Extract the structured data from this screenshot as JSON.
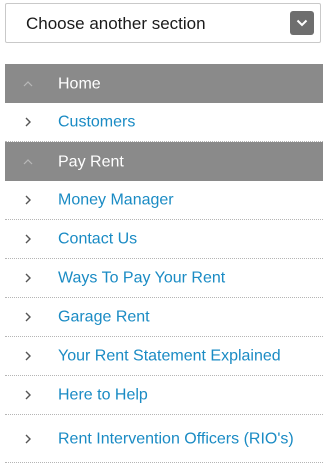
{
  "section_select": {
    "selected": "Choose another section",
    "arrow_icon": "chevron-down-icon"
  },
  "colors": {
    "link": "#1a8bc4",
    "active_bg": "#8a8a8a",
    "active_text": "#ffffff",
    "arrow_bg": "#6e6e6e"
  },
  "nav": {
    "items": [
      {
        "label": "Home",
        "state": "expanded",
        "icon": "chevron-up-icon"
      },
      {
        "label": "Customers",
        "state": "link",
        "icon": "chevron-right-icon"
      },
      {
        "label": "Pay Rent",
        "state": "expanded",
        "icon": "chevron-up-icon"
      },
      {
        "label": "Money Manager",
        "state": "link",
        "icon": "chevron-right-icon"
      },
      {
        "label": "Contact Us",
        "state": "link",
        "icon": "chevron-right-icon"
      },
      {
        "label": "Ways To Pay Your Rent",
        "state": "link",
        "icon": "chevron-right-icon"
      },
      {
        "label": "Garage Rent",
        "state": "link",
        "icon": "chevron-right-icon"
      },
      {
        "label": "Your Rent Statement Explained",
        "state": "link",
        "icon": "chevron-right-icon"
      },
      {
        "label": "Here to Help",
        "state": "link",
        "icon": "chevron-right-icon"
      },
      {
        "label": "Rent Intervention Officers (RIO's)",
        "state": "link",
        "icon": "chevron-right-icon"
      }
    ]
  }
}
